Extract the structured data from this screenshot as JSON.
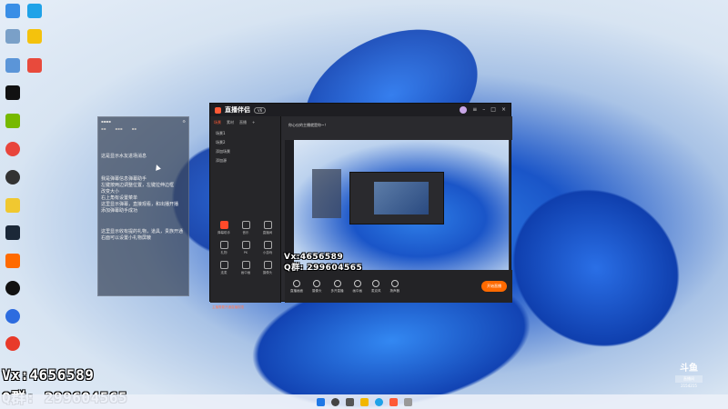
{
  "watermark": {
    "vx": "Vx:4656589",
    "qq": "Q群: 299604565"
  },
  "chat": {
    "lines": [
      "这是显示水友进场消息",
      "我是弹幕信息弹幕助手",
      "左键按两边调整位置，左键拉伸边框",
      "改变大小",
      "右上角有设置菜单",
      "这里显示弹幕，直接观看，和出播开播",
      "添加弹幕助手成功",
      "这里显示收有提的礼物，道具，贵族开通",
      "右面可以设置小礼物屏蔽"
    ]
  },
  "app": {
    "brand": "直播伴侣",
    "version": "V6",
    "tabs": [
      "场景",
      "素材",
      "直播"
    ],
    "scenes": [
      "场景1",
      "场景2",
      "添加场景",
      "添加源"
    ],
    "room": "你心仪的主播就是你~！",
    "tools": [
      "弹幕助手",
      "音乐",
      "直播间",
      "礼物",
      "PK",
      "小游戏",
      "连麦",
      "画中画",
      "摄像头"
    ],
    "bottom": [
      "直播画面",
      "摄像头",
      "多开直播",
      "画中画",
      "麦克风",
      "扬声器"
    ],
    "go_live": "开始直播",
    "status": "主播需要开通直播权限"
  },
  "douyu": {
    "logo": "斗鱼",
    "line": "直播间",
    "id": "2154215"
  }
}
